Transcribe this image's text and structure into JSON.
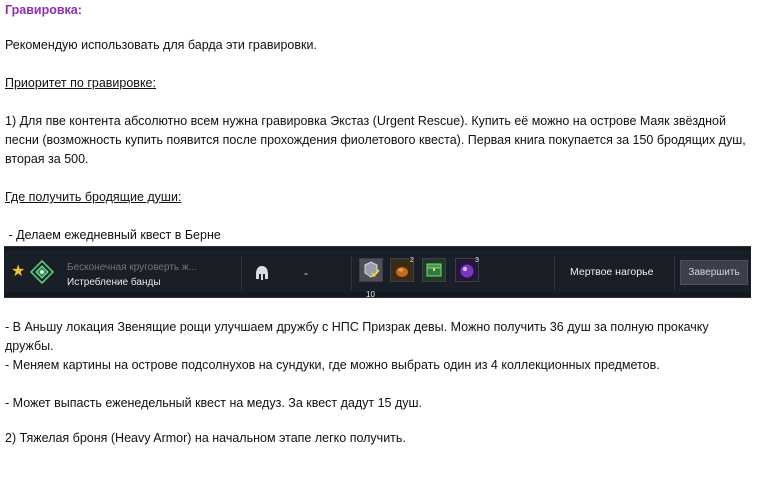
{
  "section_title": "Гравировка:",
  "intro": "Рекомендую использовать для барда эти гравировки.",
  "priority_heading": "Приоритет по гравировке:",
  "point1": "1) Для пве контента абсолютно всем нужна гравировка Экстаз (Urgent Rescue). Купить её можно на острове Маяк звёздной песни (возможность купить появится после прохождения фиолетового квеста). Первая книга покупается за 150 бродящих душ, вторая за 500.",
  "souls_heading": "Где получить бродящие души:",
  "daily_quest": " - Делаем ежедневный квест в Берне",
  "quest_bar": {
    "quest_title": "Бесконечная круговерть ж...",
    "quest_subtitle": "Истребление банды",
    "type_value": "-",
    "rewards": [
      {
        "icon": "gem-pouch-icon",
        "badge": ""
      },
      {
        "icon": "orange-gem-icon",
        "badge": "2"
      },
      {
        "icon": "green-chest-icon",
        "badge": ""
      },
      {
        "icon": "purple-orb-icon",
        "badge": "3"
      }
    ],
    "reward_count": "10",
    "location": "Мертвое нагорье",
    "finish_button": "Завершить",
    "colors": {
      "bar_bg": "#141820",
      "star": "#f3c02a",
      "emblem": "#4fcf7a"
    }
  },
  "bullet_anshu": "- В Аньшу локация Звенящие рощи улучшаем дружбу с НПС Призрак девы. Можно получить 36 душ за полную прокачку дружбы.",
  "bullet_paintings": "- Меняем картины на острове подсолнухов на сундуки, где можно выбрать один из 4 коллекционных предметов.",
  "bullet_weekly": "- Может выпасть еженедельный квест на медуз. За квест дадут 15 душ.",
  "point2": "2) Тяжелая броня (Heavy Armor) на начальном этапе легко получить."
}
